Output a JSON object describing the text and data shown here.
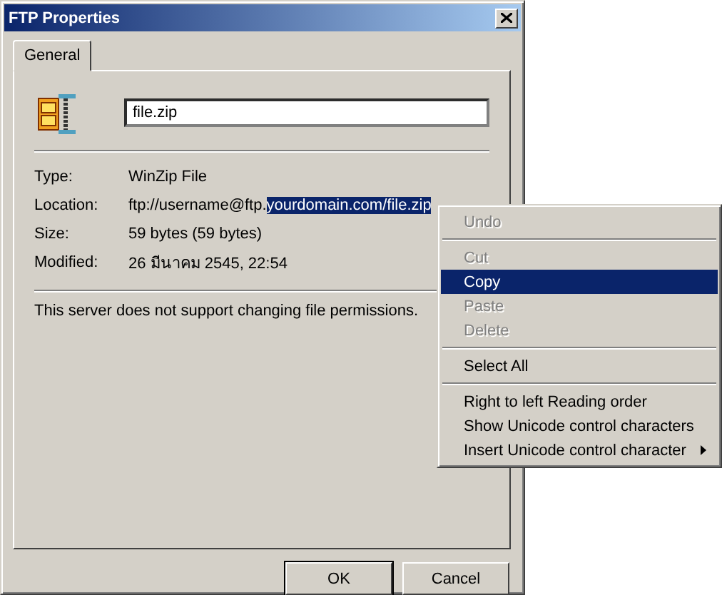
{
  "window": {
    "title": "FTP Properties"
  },
  "tabs": [
    {
      "label": "General",
      "selected": true
    }
  ],
  "file_name": {
    "value": "file.zip"
  },
  "properties": [
    {
      "label": "Type:",
      "value_parts": [
        {
          "text": "WinZip File",
          "selected": false
        }
      ]
    },
    {
      "label": "Location:",
      "value_parts": [
        {
          "text": "ftp://username@ftp.",
          "selected": false
        },
        {
          "text": "yourdomain.com/file.zip",
          "selected": true
        }
      ]
    },
    {
      "label": "Size:",
      "value_parts": [
        {
          "text": "59 bytes (59 bytes)",
          "selected": false
        }
      ]
    },
    {
      "label": "Modified:",
      "value_parts": [
        {
          "text": "26 มีนาคม 2545, 22:54",
          "selected": false
        }
      ]
    }
  ],
  "message": "This server does not support changing file permissions.",
  "buttons": [
    {
      "label": "OK",
      "default": true
    },
    {
      "label": "Cancel",
      "default": false
    }
  ],
  "context_menu": [
    {
      "kind": "item",
      "label": "Undo",
      "disabled": true,
      "selected": false
    },
    {
      "kind": "separator"
    },
    {
      "kind": "item",
      "label": "Cut",
      "disabled": true,
      "selected": false
    },
    {
      "kind": "item",
      "label": "Copy",
      "disabled": false,
      "selected": true
    },
    {
      "kind": "item",
      "label": "Paste",
      "disabled": true,
      "selected": false
    },
    {
      "kind": "item",
      "label": "Delete",
      "disabled": true,
      "selected": false
    },
    {
      "kind": "separator"
    },
    {
      "kind": "item",
      "label": "Select All",
      "disabled": false,
      "selected": false
    },
    {
      "kind": "separator"
    },
    {
      "kind": "item",
      "label": "Right to left Reading order",
      "disabled": false,
      "selected": false
    },
    {
      "kind": "item",
      "label": "Show Unicode control characters",
      "disabled": false,
      "selected": false
    },
    {
      "kind": "submenu",
      "label": "Insert Unicode control character",
      "disabled": false,
      "selected": false
    }
  ]
}
